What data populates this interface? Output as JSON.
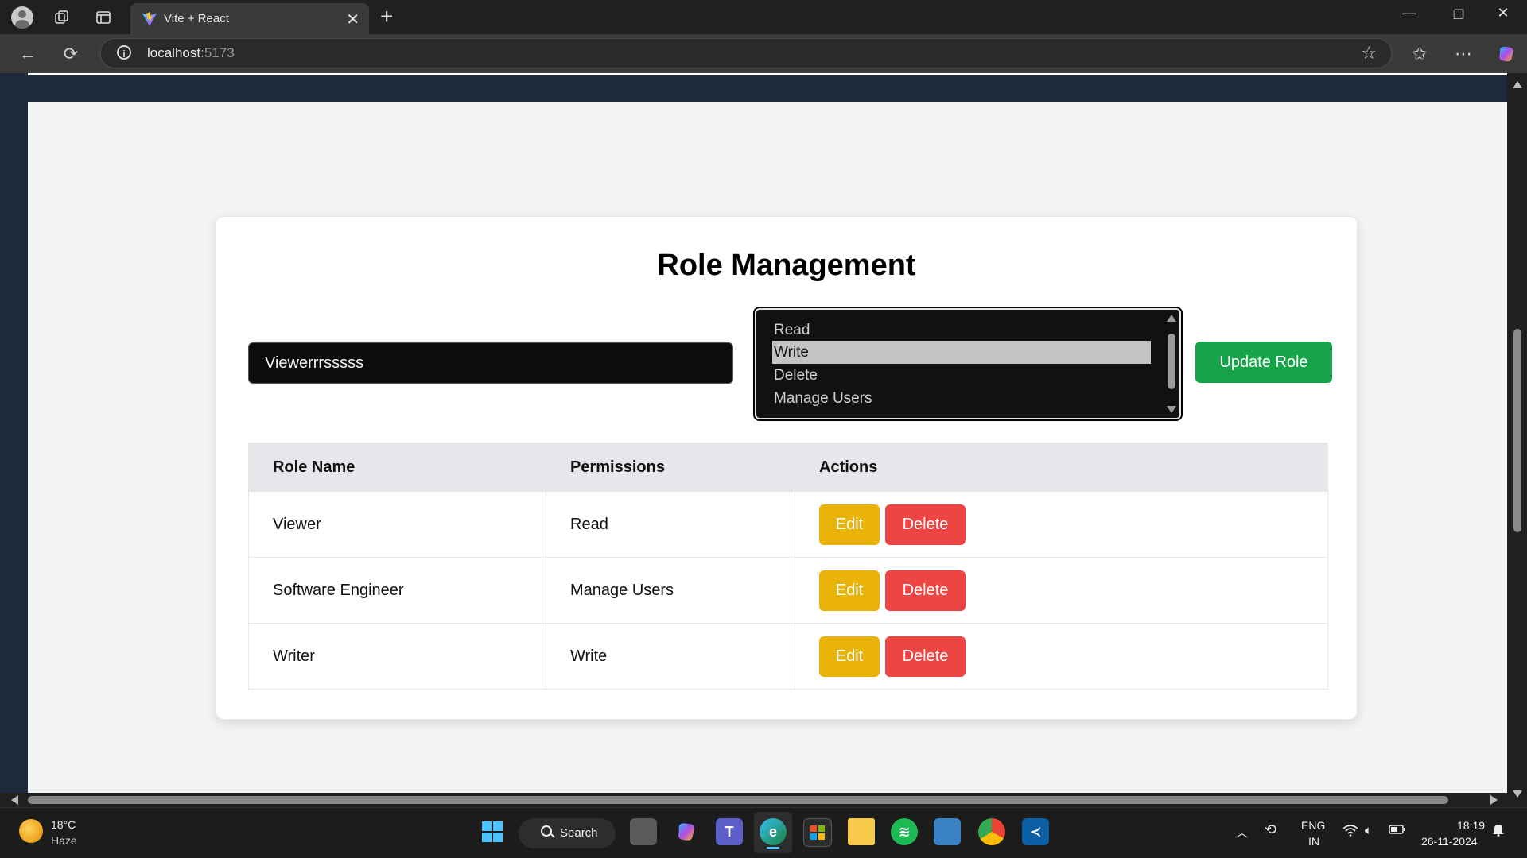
{
  "browser": {
    "tab_title": "Vite + React",
    "url_host": "localhost",
    "url_port": ":5173"
  },
  "page": {
    "title": "Role Management",
    "role_input_value": "Viewerrrsssss",
    "permissions_options": [
      "Read",
      "Write",
      "Delete",
      "Manage Users"
    ],
    "permissions_selected": "Write",
    "update_button": "Update Role",
    "table": {
      "headers": [
        "Role Name",
        "Permissions",
        "Actions"
      ],
      "rows": [
        {
          "role": "Viewer",
          "permissions": "Read"
        },
        {
          "role": "Software Engineer",
          "permissions": "Manage Users"
        },
        {
          "role": "Writer",
          "permissions": "Write"
        }
      ],
      "edit_label": "Edit",
      "delete_label": "Delete"
    }
  },
  "taskbar": {
    "weather_temp": "18°C",
    "weather_cond": "Haze",
    "search_label": "Search",
    "lang_line1": "ENG",
    "lang_line2": "IN",
    "time": "18:19",
    "date": "26-11-2024"
  },
  "colors": {
    "update_button": "#16a34a",
    "edit_button": "#eab308",
    "delete_button": "#ef4444",
    "page_background": "#f3f4f6",
    "app_frame": "#1e293b"
  }
}
